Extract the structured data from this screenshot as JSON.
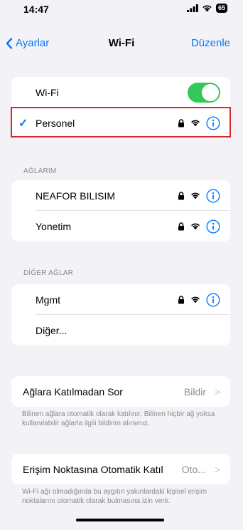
{
  "status_bar": {
    "time": "14:47",
    "battery": "65"
  },
  "nav": {
    "back_label": "Ayarlar",
    "title": "Wi-Fi",
    "edit_label": "Düzenle"
  },
  "wifi_group": {
    "wifi_label": "Wi-Fi",
    "wifi_on": true,
    "connected_network": "Personel"
  },
  "my_networks": {
    "header": "AĞLARIM",
    "items": [
      {
        "name": "NEAFOR BILISIM"
      },
      {
        "name": "Yonetim"
      }
    ]
  },
  "other_networks": {
    "header": "DİĞER AĞLAR",
    "items": [
      {
        "name": "Mgmt"
      }
    ],
    "other_label": "Diğer..."
  },
  "ask_to_join": {
    "label": "Ağlara Katılmadan Sor",
    "value": "Bildir",
    "footer": "Bilinen ağlara otomatik olarak katılınır. Bilinen hiçbir ağ yoksa kullanılabilir ağlarla ilgili bildirim alırsınız."
  },
  "auto_join_hotspot": {
    "label": "Erişim Noktasına Otomatik Katıl",
    "value": "Oto...",
    "footer": "Wi-Fi ağı olmadığında bu aygıtın yakınlardaki kişisel erişim noktalarını otomatik olarak bulmasına izin verir."
  },
  "colors": {
    "accent": "#007aff",
    "toggle_on": "#34c759",
    "highlight": "#d9262c",
    "background": "#f2f2f7"
  }
}
